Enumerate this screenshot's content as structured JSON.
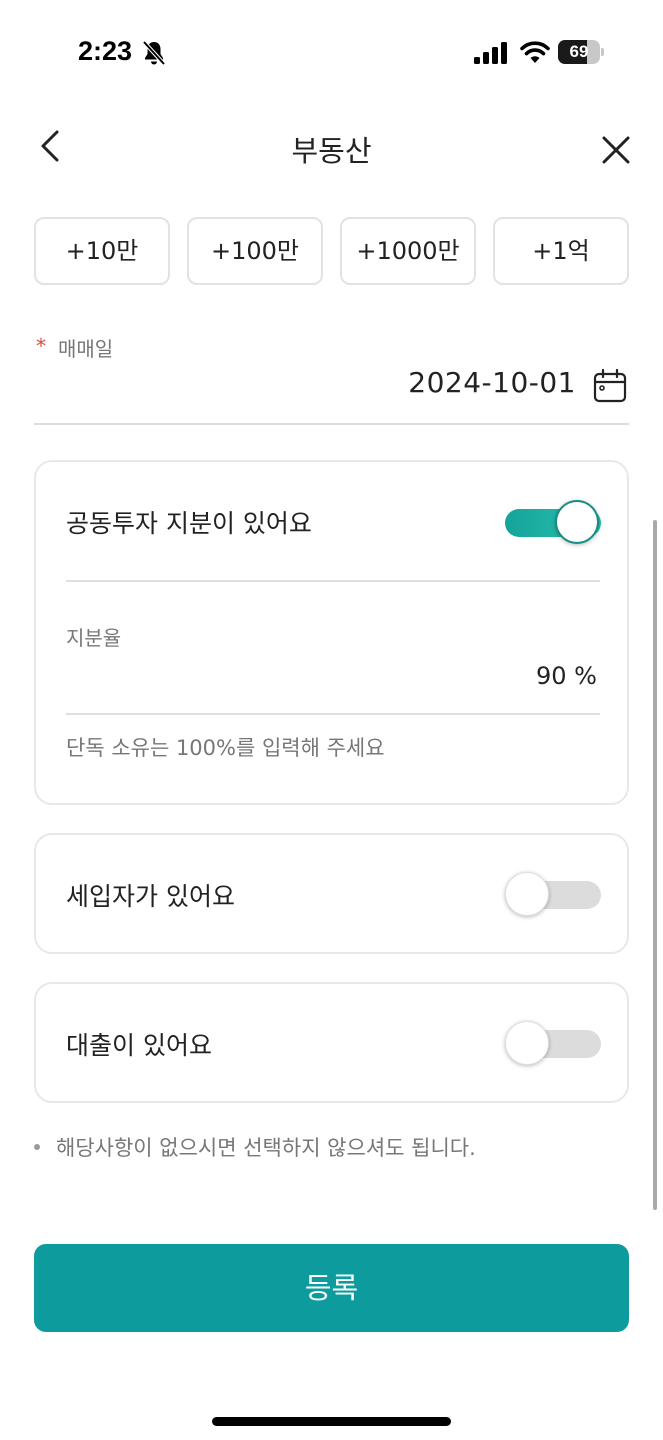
{
  "status_bar": {
    "time": "2:23",
    "battery_level": "69",
    "battery_fraction": 0.69,
    "icons": [
      "bell-off-icon",
      "signal-icon",
      "wifi-icon",
      "battery-icon"
    ]
  },
  "header": {
    "title": "부동산",
    "back_icon": "chevron-left-icon",
    "close_icon": "close-icon"
  },
  "amount_buttons": [
    "+10만",
    "+100만",
    "+1000만",
    "+1억"
  ],
  "date_field": {
    "required_mark": "*",
    "label": "매매일",
    "value": "2024-10-01",
    "icon": "calendar-icon"
  },
  "joint_investment": {
    "label": "공동투자 지분이 있어요",
    "enabled": true,
    "share_label": "지분율",
    "share_value": "90 %",
    "hint": "단독 소유는 100%를 입력해 주세요"
  },
  "tenant": {
    "label": "세입자가 있어요",
    "enabled": false
  },
  "loan": {
    "label": "대출이 있어요",
    "enabled": false
  },
  "note": "해당사항이 없으시면 선택하지 않으셔도 됩니다.",
  "submit_label": "등록",
  "colors": {
    "accent": "#0e9b9e",
    "toggle_on": "#1fb0a3",
    "required": "#e0463d"
  }
}
